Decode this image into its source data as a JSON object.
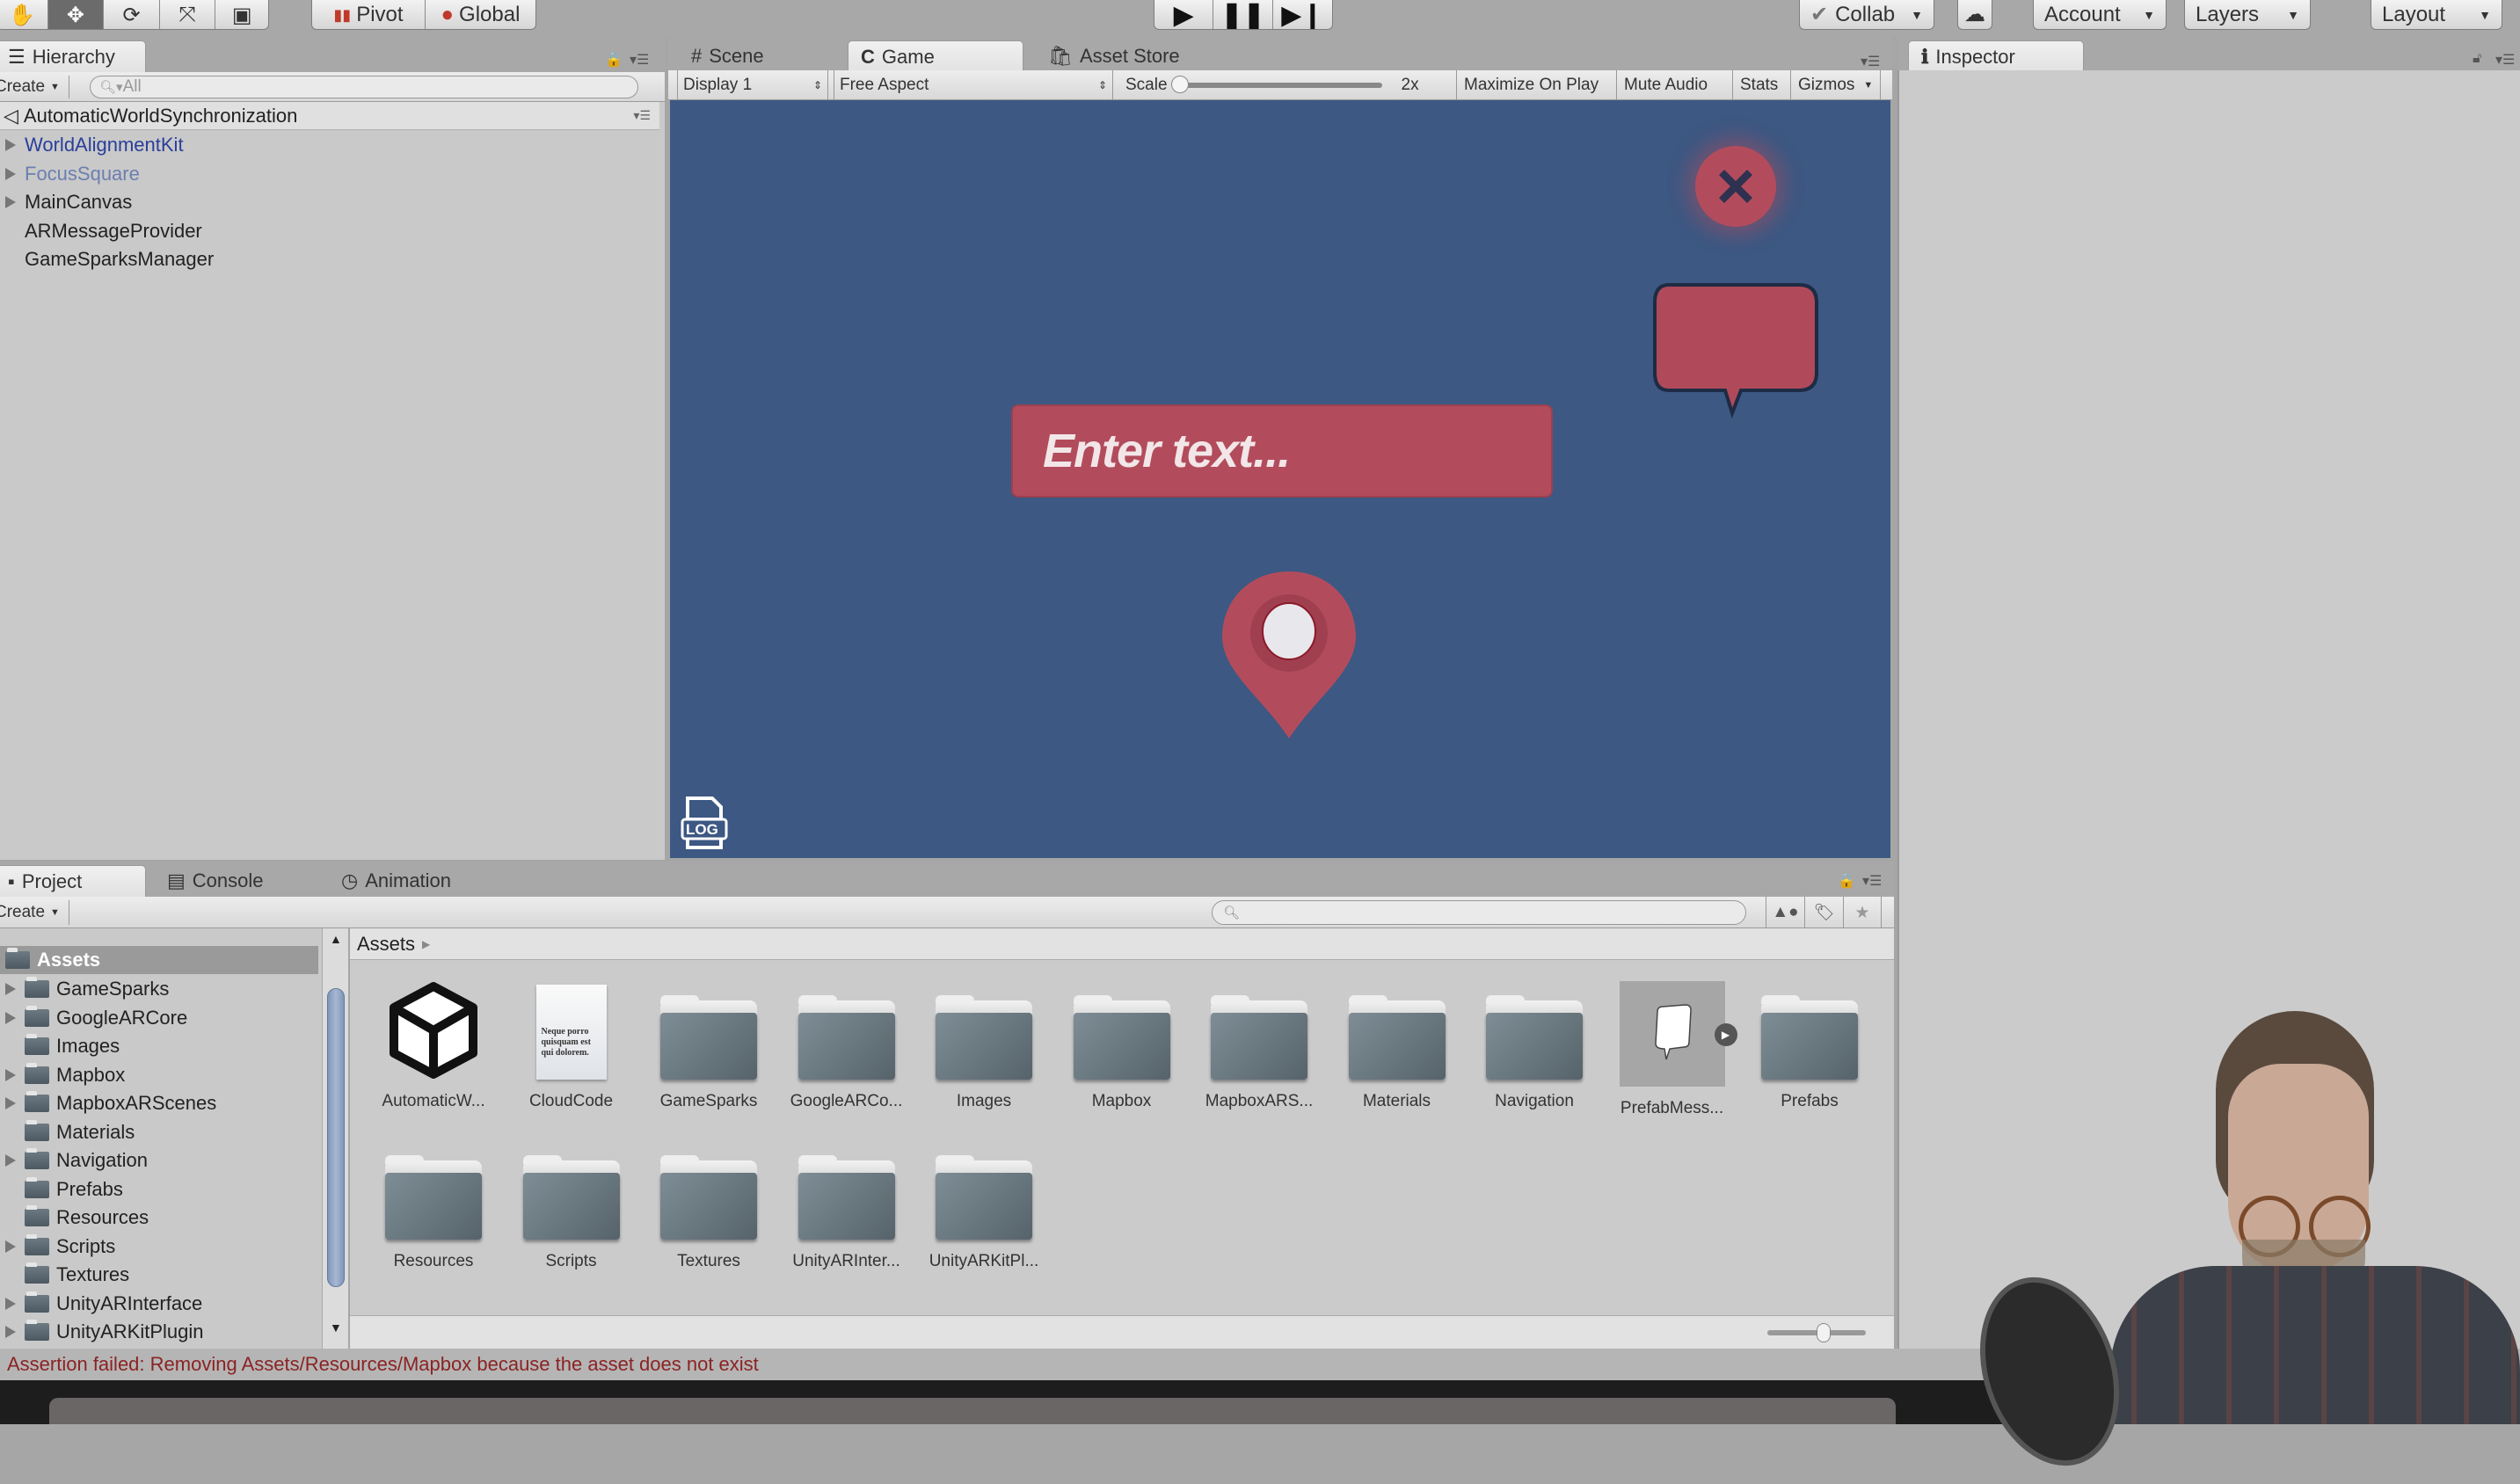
{
  "toolbar": {
    "transform_tools": [
      "hand-tool",
      "move-tool",
      "rotate-tool",
      "scale-tool",
      "rect-tool"
    ],
    "active_tool": "move-tool",
    "pivot_label": "Pivot",
    "global_label": "Global",
    "play_controls": [
      "play",
      "pause",
      "step"
    ],
    "collab_label": "Collab",
    "account_label": "Account",
    "layers_label": "Layers",
    "layout_label": "Layout"
  },
  "hierarchy": {
    "tab_label": "Hierarchy",
    "create_label": "Create",
    "search_placeholder": "All",
    "scene_name": "AutomaticWorldSynchronization",
    "items": [
      {
        "label": "WorldAlignmentKit",
        "expandable": true,
        "color": "#2a3f9a"
      },
      {
        "label": "FocusSquare",
        "expandable": true,
        "color": "#6b7fb0"
      },
      {
        "label": "MainCanvas",
        "expandable": true,
        "color": "#222222"
      },
      {
        "label": "ARMessageProvider",
        "expandable": false,
        "color": "#222222"
      },
      {
        "label": "GameSparksManager",
        "expandable": false,
        "color": "#222222"
      }
    ]
  },
  "center_tabs": {
    "tabs": [
      {
        "label": "Scene",
        "active": false
      },
      {
        "label": "Game",
        "active": true
      },
      {
        "label": "Asset Store",
        "active": false
      }
    ],
    "display_label": "Display 1",
    "aspect_label": "Free Aspect",
    "scale_label": "Scale",
    "scale_value": "2x",
    "maximize_label": "Maximize On Play",
    "mute_label": "Mute Audio",
    "stats_label": "Stats",
    "gizmos_label": "Gizmos"
  },
  "game_view": {
    "background": "#3c5883",
    "accent": "#b24c5c",
    "input_placeholder": "Enter text...",
    "log_label": "LOG"
  },
  "inspector": {
    "tab_label": "Inspector"
  },
  "project": {
    "tabs": [
      {
        "label": "Project",
        "active": true
      },
      {
        "label": "Console",
        "active": false
      },
      {
        "label": "Animation",
        "active": false
      }
    ],
    "create_label": "Create",
    "search_placeholder": "",
    "breadcrumb": "Assets",
    "tree_root": "Assets",
    "tree": [
      {
        "label": "GameSparks",
        "expandable": true
      },
      {
        "label": "GoogleARCore",
        "expandable": true
      },
      {
        "label": "Images",
        "expandable": false
      },
      {
        "label": "Mapbox",
        "expandable": true
      },
      {
        "label": "MapboxARScenes",
        "expandable": true
      },
      {
        "label": "Materials",
        "expandable": false
      },
      {
        "label": "Navigation",
        "expandable": true
      },
      {
        "label": "Prefabs",
        "expandable": false
      },
      {
        "label": "Resources",
        "expandable": false
      },
      {
        "label": "Scripts",
        "expandable": true
      },
      {
        "label": "Textures",
        "expandable": false
      },
      {
        "label": "UnityARInterface",
        "expandable": true
      },
      {
        "label": "UnityARKitPlugin",
        "expandable": true
      }
    ],
    "assets": [
      {
        "label": "AutomaticW...",
        "type": "unity-scene"
      },
      {
        "label": "CloudCode",
        "type": "text-file"
      },
      {
        "label": "GameSparks",
        "type": "folder"
      },
      {
        "label": "GoogleARCo...",
        "type": "folder"
      },
      {
        "label": "Images",
        "type": "folder"
      },
      {
        "label": "Mapbox",
        "type": "folder"
      },
      {
        "label": "MapboxARS...",
        "type": "folder"
      },
      {
        "label": "Materials",
        "type": "folder"
      },
      {
        "label": "Navigation",
        "type": "folder"
      },
      {
        "label": "PrefabMess...",
        "type": "prefab",
        "selected": true
      },
      {
        "label": "Prefabs",
        "type": "folder"
      },
      {
        "label": "Resources",
        "type": "folder"
      },
      {
        "label": "Scripts",
        "type": "folder"
      },
      {
        "label": "Textures",
        "type": "folder"
      },
      {
        "label": "UnityARInter...",
        "type": "folder"
      },
      {
        "label": "UnityARKitPl...",
        "type": "folder"
      }
    ],
    "text_file_preview": "Neque porro quisquam est qui dolorem."
  },
  "console": {
    "message": "Assertion failed: Removing Assets/Resources/Mapbox because the asset does not exist",
    "color": "#8b2323"
  }
}
